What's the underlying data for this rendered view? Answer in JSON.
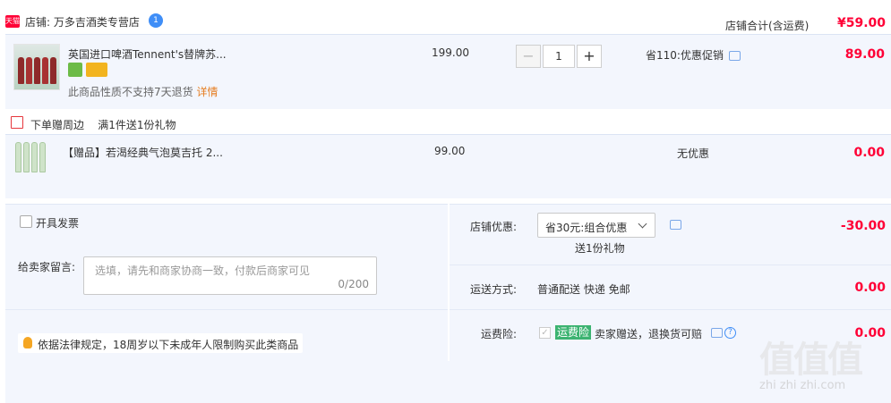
{
  "shop": {
    "badge": "天猫",
    "name": "店铺: 万多吉酒类专营店",
    "chat_count": "1"
  },
  "items": [
    {
      "title": "英国进口啤酒Tennent's替牌苏...",
      "note": "此商品性质不支持7天退货",
      "note_link": "详情",
      "unit_price": "199.00",
      "quantity": "1",
      "minus": "−",
      "plus": "+",
      "promo": "省110:优惠促销",
      "amount": "89.00"
    },
    {
      "title": "【赠品】若渴经典气泡莫吉托 2...",
      "unit_price": "99.00",
      "promo": "无优惠",
      "amount": "0.00"
    }
  ],
  "gift_bar": {
    "label": "下单赠周边",
    "rule": "满1件送1份礼物"
  },
  "invoice": {
    "label": "开具发票"
  },
  "message": {
    "label": "给卖家留言:",
    "placeholder": "选填，请先和商家协商一致，付款后商家可见",
    "counter": "0/200"
  },
  "notice": "依据法律规定，18周岁以下未成年人限制购买此类商品",
  "shop_discount": {
    "label": "店铺优惠:",
    "selected": "省30元:组合优惠",
    "sub": "送1份礼物",
    "amount": "-30.00"
  },
  "shipping": {
    "label": "运送方式:",
    "value": "普通配送 快递 免邮",
    "amount": "0.00"
  },
  "insurance": {
    "label": "运费险:",
    "badge": "运费险",
    "desc": "卖家赠送，退换货可赔",
    "amount": "0.00"
  },
  "total": {
    "label": "店铺合计(含运费)",
    "value": "¥59.00"
  },
  "watermark": {
    "logo": "值值值",
    "site": "zhi zhi zhi.com"
  },
  "colors": {
    "accent": "#ff0036",
    "panel": "#f3f6fd",
    "badge_green": "#3cb371"
  }
}
